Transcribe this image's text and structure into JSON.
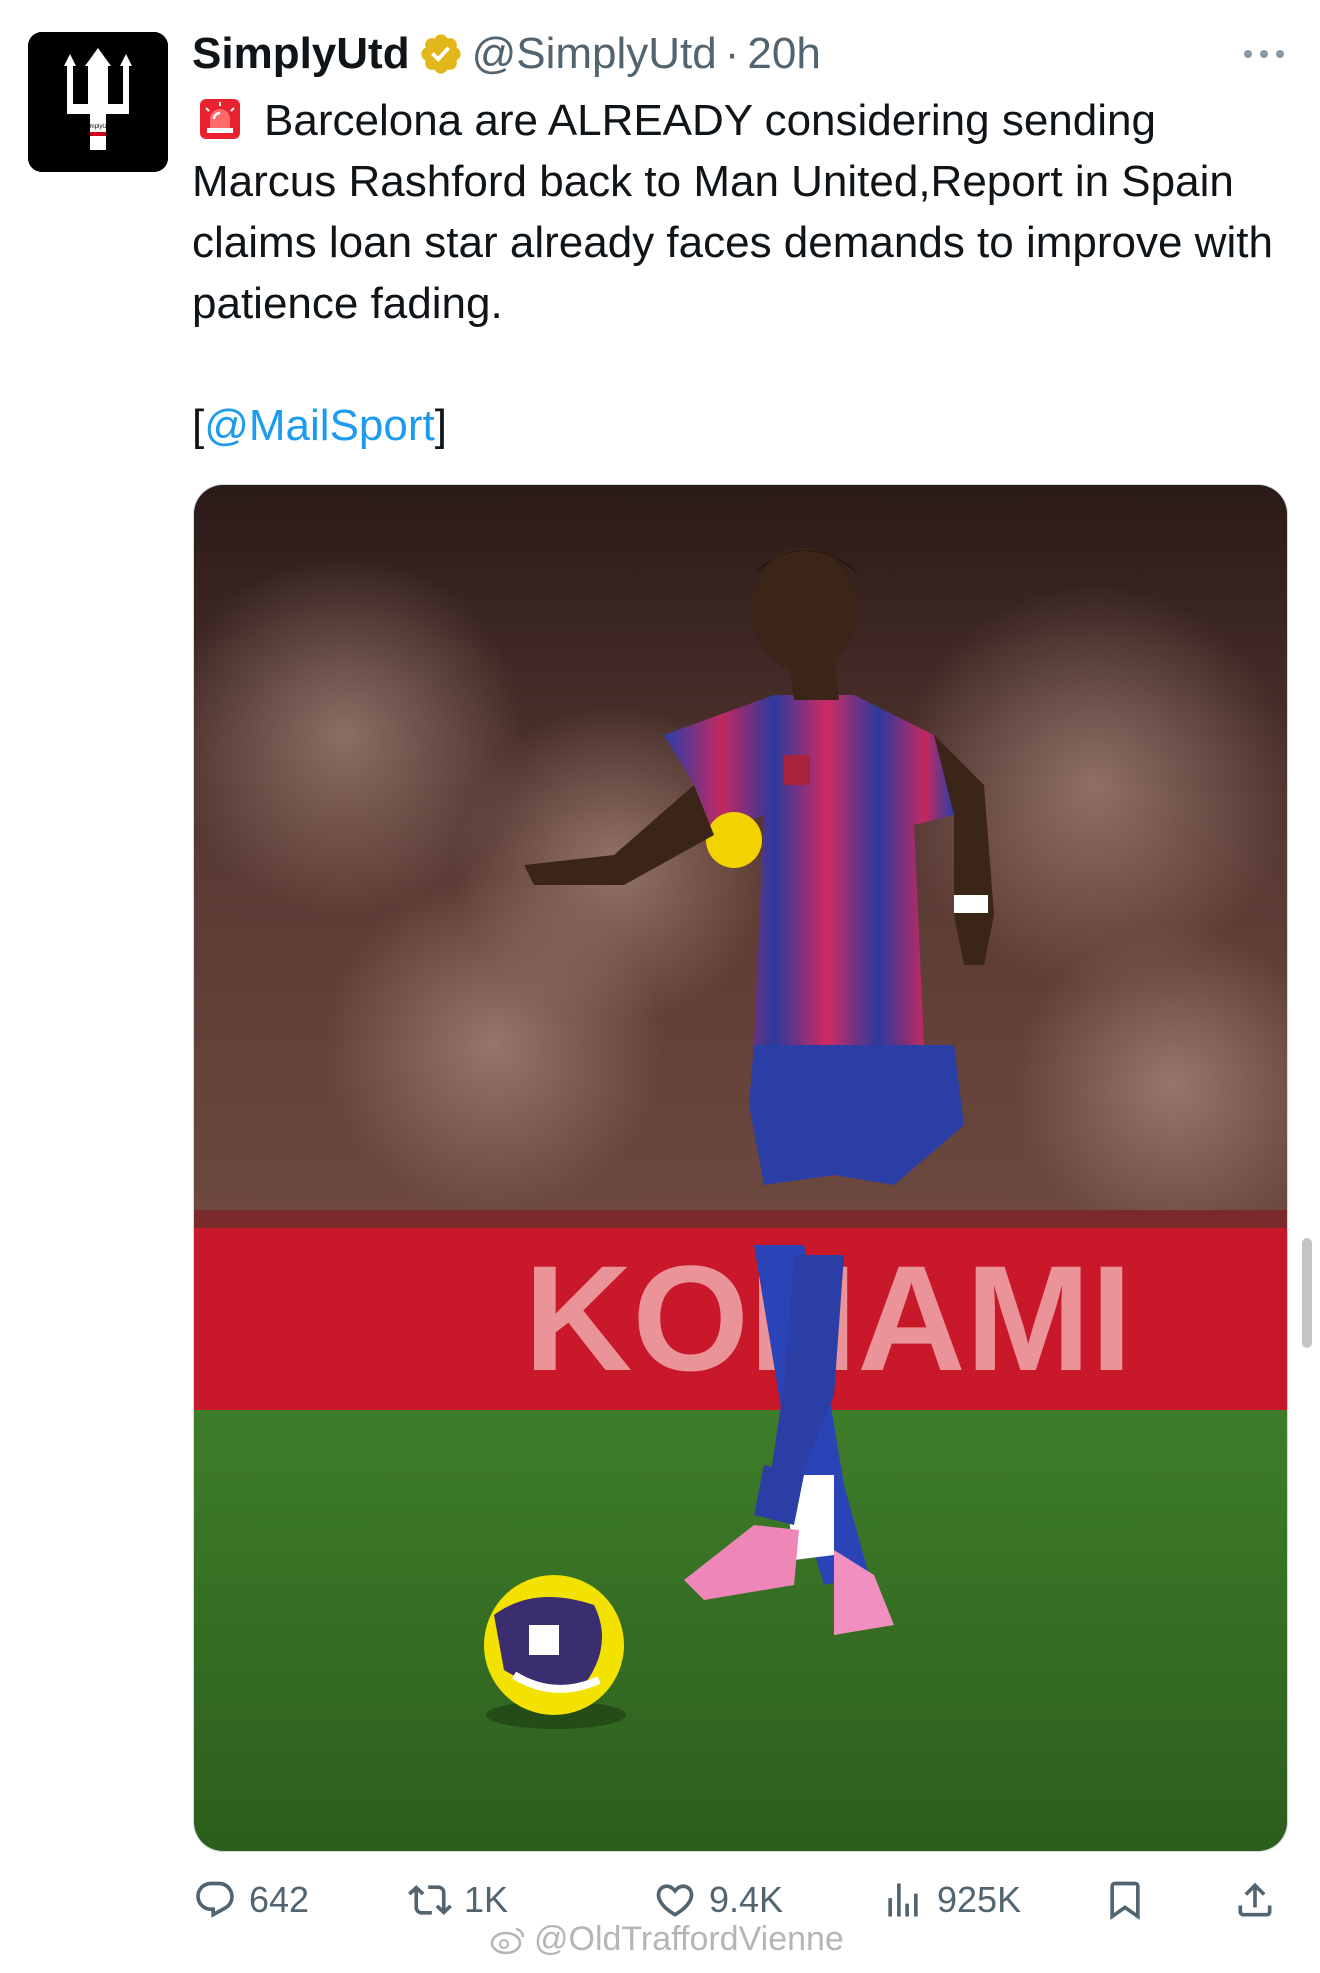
{
  "author": {
    "display_name": "SimplyUtd",
    "handle": "@SimplyUtd",
    "separator": "·",
    "time": "20h",
    "avatar_icon": "trident-logo",
    "avatar_caption": "SimplyUtd",
    "verified_color": "#e2b719"
  },
  "tweet": {
    "line1_emoji": "rotating-light-icon",
    "text": "Barcelona are ALREADY considering sending Marcus Rashford back to Man United,Report in Spain claims loan star already faces demands to improve with patience fading.",
    "source_open": "[",
    "source_mention": "@MailSport",
    "source_close": "]"
  },
  "media": {
    "kind": "photo",
    "description_icon": "football-player-photo"
  },
  "actions": {
    "replies": "642",
    "reposts": "1K",
    "likes": "9.4K",
    "views": "925K"
  },
  "watermark": {
    "text": "@OldTraffordVienne"
  },
  "colors": {
    "text": "#0f1419",
    "secondary": "#536471",
    "link": "#1d9bf0"
  }
}
